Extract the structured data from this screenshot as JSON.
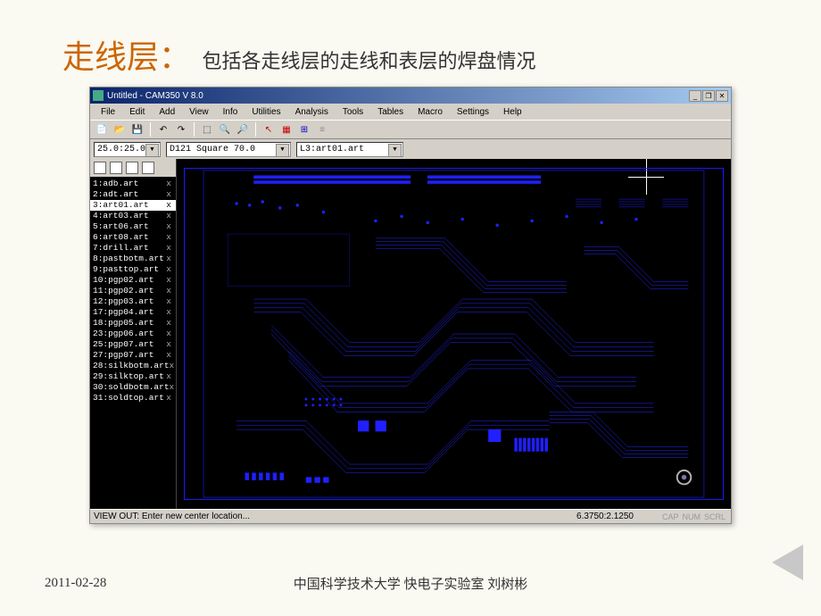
{
  "slide": {
    "title_main": "走线层：",
    "title_sub": "包括各走线层的走线和表层的焊盘情况"
  },
  "window": {
    "title": "Untitled - CAM350 V 8.0",
    "menus": [
      "File",
      "Edit",
      "Add",
      "View",
      "Info",
      "Utilities",
      "Analysis",
      "Tools",
      "Tables",
      "Macro",
      "Settings",
      "Help"
    ]
  },
  "dropdowns": {
    "coord": "25.0:25.0",
    "dcode": "D121   Square 70.0",
    "layer": "L3:art01.art"
  },
  "layers": [
    {
      "idx": "1",
      "name": "adb.art",
      "on": true
    },
    {
      "idx": "2",
      "name": "adt.art",
      "on": true
    },
    {
      "idx": "3",
      "name": "art01.art",
      "on": true,
      "selected": true
    },
    {
      "idx": "4",
      "name": "art03.art",
      "on": true
    },
    {
      "idx": "5",
      "name": "art06.art",
      "on": true
    },
    {
      "idx": "6",
      "name": "art08.art",
      "on": true
    },
    {
      "idx": "7",
      "name": "drill.art",
      "on": true
    },
    {
      "idx": "8",
      "name": "pastbotm.art",
      "on": true
    },
    {
      "idx": "9",
      "name": "pasttop.art",
      "on": true
    },
    {
      "idx": "10",
      "name": "pgp02.art",
      "on": true
    },
    {
      "idx": "11",
      "name": "pgp02.art",
      "on": true
    },
    {
      "idx": "12",
      "name": "pgp03.art",
      "on": true
    },
    {
      "idx": "17",
      "name": "pgp04.art",
      "on": true
    },
    {
      "idx": "18",
      "name": "pgp05.art",
      "on": true
    },
    {
      "idx": "23",
      "name": "pgp06.art",
      "on": true
    },
    {
      "idx": "25",
      "name": "pgp07.art",
      "on": true
    },
    {
      "idx": "27",
      "name": "pgp07.art",
      "on": true
    },
    {
      "idx": "28",
      "name": "silkbotm.art",
      "on": true
    },
    {
      "idx": "29",
      "name": "silktop.art",
      "on": true
    },
    {
      "idx": "30",
      "name": "soldbotm.art",
      "on": true
    },
    {
      "idx": "31",
      "name": "soldtop.art",
      "on": true
    }
  ],
  "statusbar": {
    "text": "VIEW OUT: Enter new center location...",
    "coord": "6.3750:2.1250",
    "indicators": [
      "CAP",
      "NUM",
      "SCRL"
    ]
  },
  "footer": {
    "date": "2011-02-28",
    "org": "中国科学技术大学 快电子实验室 刘树彬"
  }
}
